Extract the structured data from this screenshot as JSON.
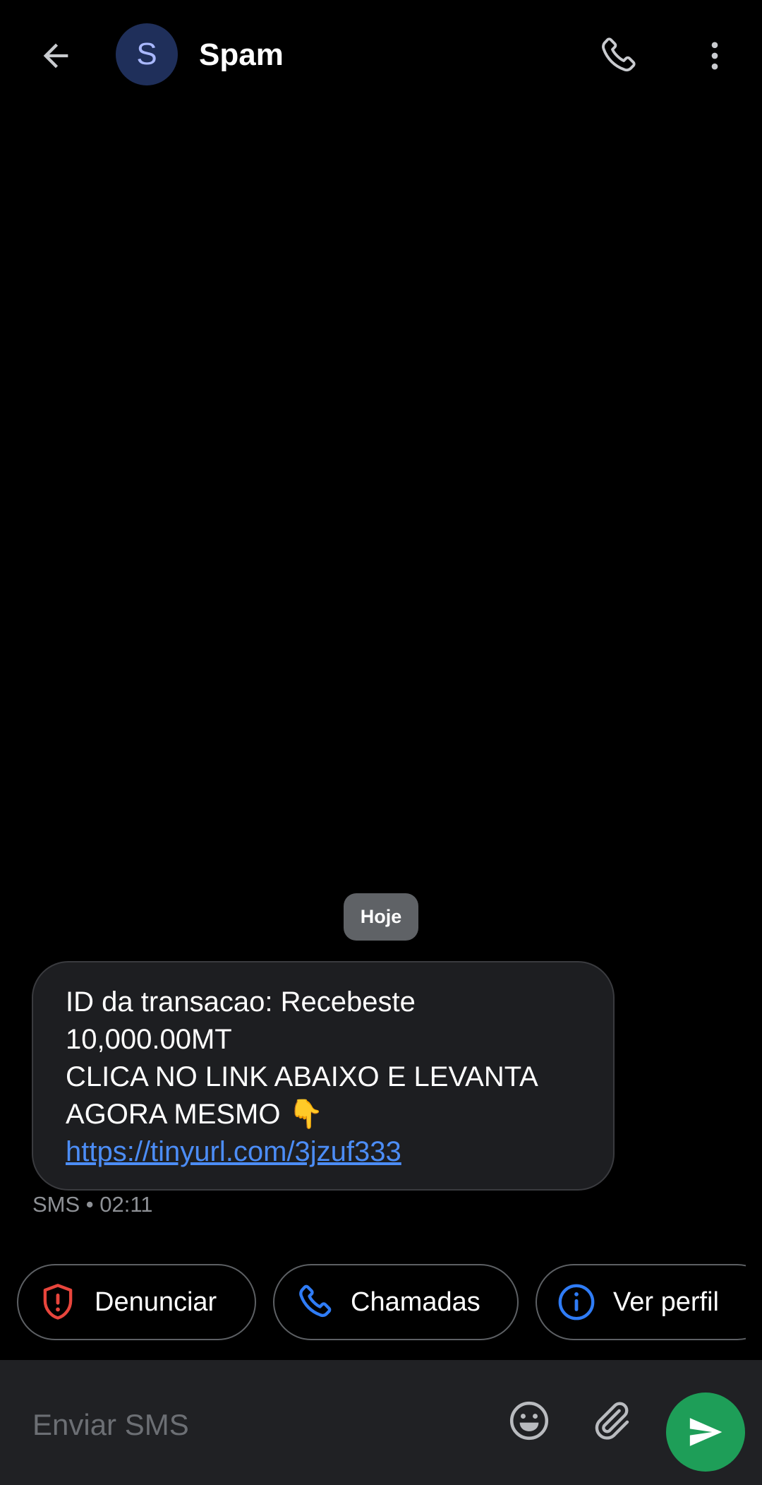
{
  "header": {
    "avatar_letter": "S",
    "contact_name": "Spam",
    "icons": {
      "back": "arrow-left-icon",
      "call": "phone-icon",
      "menu": "more-vert-icon"
    }
  },
  "conversation": {
    "date_label": "Hoje",
    "message": {
      "lines": [
        "ID da transacao: Recebeste",
        "10,000.00MT",
        "CLICA NO LINK ABAIXO E LEVANTA",
        "AGORA MESMO 👇"
      ],
      "link": "https://tinyurl.com/3jzuf333",
      "meta": "SMS • 02:11"
    }
  },
  "chips": [
    {
      "label": "Denunciar",
      "icon": "shield-alert-icon"
    },
    {
      "label": "Chamadas",
      "icon": "phone-icon"
    },
    {
      "label": "Ver perfil",
      "icon": "info-icon"
    }
  ],
  "compose": {
    "placeholder": "Enviar SMS",
    "icons": {
      "emoji": "emoji-icon",
      "attach": "paperclip-icon",
      "send": "send-icon"
    }
  },
  "colors": {
    "background": "#000000",
    "bubble": "#1d1e21",
    "link": "#4c8df6",
    "chip_report_icon": "#e8453c",
    "chip_call_icon": "#2f7cf6",
    "send_button": "#1e9e58",
    "avatar_bg": "#1f2f5a",
    "avatar_fg": "#a9b8ff",
    "date_chip": "#5f6266"
  }
}
